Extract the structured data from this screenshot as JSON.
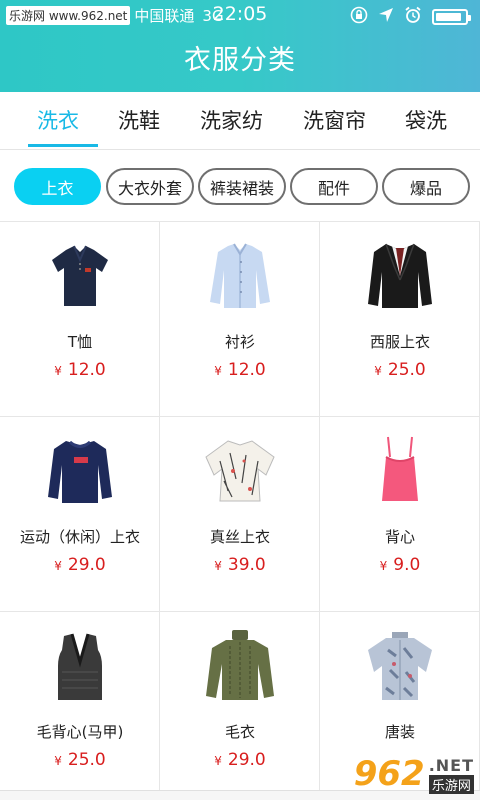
{
  "status_bar": {
    "watermark": "乐游网 www.962.net",
    "carrier": "中国联通",
    "network": "3G",
    "time": "22:05",
    "icons": [
      "lock-rotation-icon",
      "location-arrow-icon",
      "alarm-icon",
      "battery-icon"
    ],
    "battery_level": 0.9
  },
  "header": {
    "title": "衣服分类"
  },
  "tabs": [
    {
      "label": "洗衣",
      "active": true
    },
    {
      "label": "洗鞋"
    },
    {
      "label": "洗家纺"
    },
    {
      "label": "洗窗帘"
    },
    {
      "label": "袋洗"
    }
  ],
  "chips": [
    {
      "label": "上衣",
      "active": true
    },
    {
      "label": "大衣外套"
    },
    {
      "label": "裤装裙装"
    },
    {
      "label": "配件"
    },
    {
      "label": "爆品"
    }
  ],
  "currency_symbol": "¥",
  "products": [
    {
      "name": "T恤",
      "price": "12.0",
      "icon": "polo-shirt-icon"
    },
    {
      "name": "衬衫",
      "price": "12.0",
      "icon": "dress-shirt-icon"
    },
    {
      "name": "西服上衣",
      "price": "25.0",
      "icon": "suit-jacket-icon"
    },
    {
      "name": "运动（休闲）上衣",
      "price": "29.0",
      "icon": "sweatshirt-icon"
    },
    {
      "name": "真丝上衣",
      "price": "39.0",
      "icon": "silk-blouse-icon"
    },
    {
      "name": "背心",
      "price": "9.0",
      "icon": "camisole-icon"
    },
    {
      "name": "毛背心(马甲)",
      "price": "25.0",
      "icon": "sweater-vest-icon"
    },
    {
      "name": "毛衣",
      "price": "29.0",
      "icon": "knit-sweater-icon"
    },
    {
      "name": "唐装",
      "price": "",
      "icon": "tang-shirt-icon"
    }
  ],
  "watermark_bottom": {
    "number": "962",
    "suffix": ".NET",
    "name": "乐游网"
  },
  "colors": {
    "accent": "#19b9e6",
    "chip_active": "#0ad0f2",
    "price": "#d81e1e",
    "header_start": "#2ec7c6",
    "header_end": "#4fb6d6"
  }
}
